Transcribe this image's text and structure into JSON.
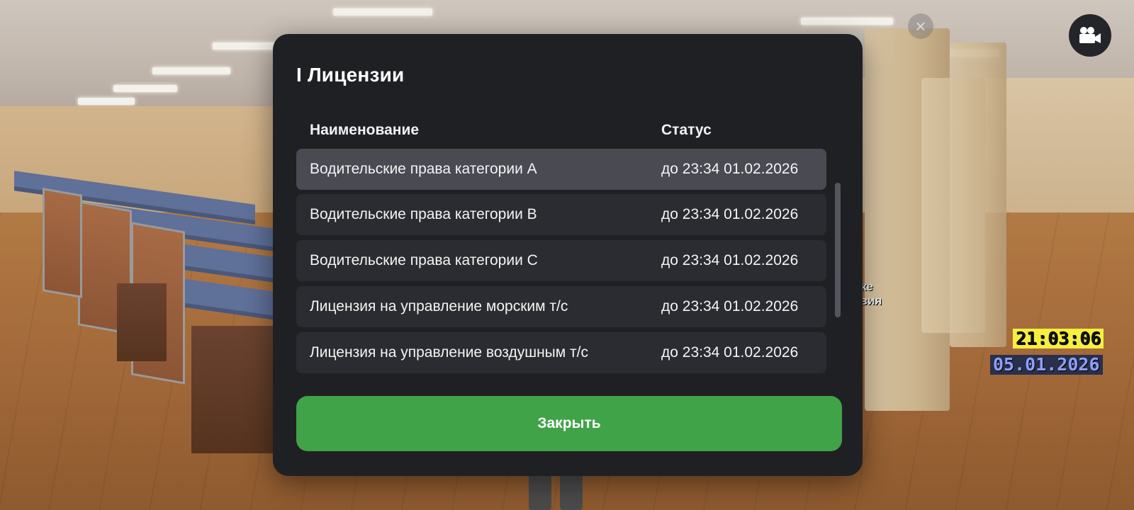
{
  "dialog": {
    "title": "I Лицензии",
    "columns": {
      "name": "Наименование",
      "status": "Статус"
    },
    "rows": [
      {
        "name": "Водительские права категории A",
        "status": "до 23:34 01.02.2026",
        "selected": true
      },
      {
        "name": "Водительские права категории B",
        "status": "до 23:34 01.02.2026",
        "selected": false
      },
      {
        "name": "Водительские права категории C",
        "status": "до 23:34 01.02.2026",
        "selected": false
      },
      {
        "name": "Лицензия на управление морским т/с",
        "status": "до 23:34 01.02.2026",
        "selected": false
      },
      {
        "name": "Лицензия на управление воздушным т/с",
        "status": "до 23:34 01.02.2026",
        "selected": false
      }
    ],
    "close_label": "Закрыть"
  },
  "hud": {
    "time": "21:03:06",
    "date": "05.01.2026",
    "hint_line1": "е ближе",
    "hint_line2": "действия"
  },
  "icons": {
    "video": "video-camera-icon",
    "close_faded": "close-icon"
  },
  "colors": {
    "dialog_bg": "#1f2024",
    "row_bg": "#2b2c31",
    "row_selected_bg": "#494a52",
    "close_button": "#40a348",
    "hud_time_bg": "#f6ef3f",
    "hud_date_text": "#8fa0ff"
  }
}
